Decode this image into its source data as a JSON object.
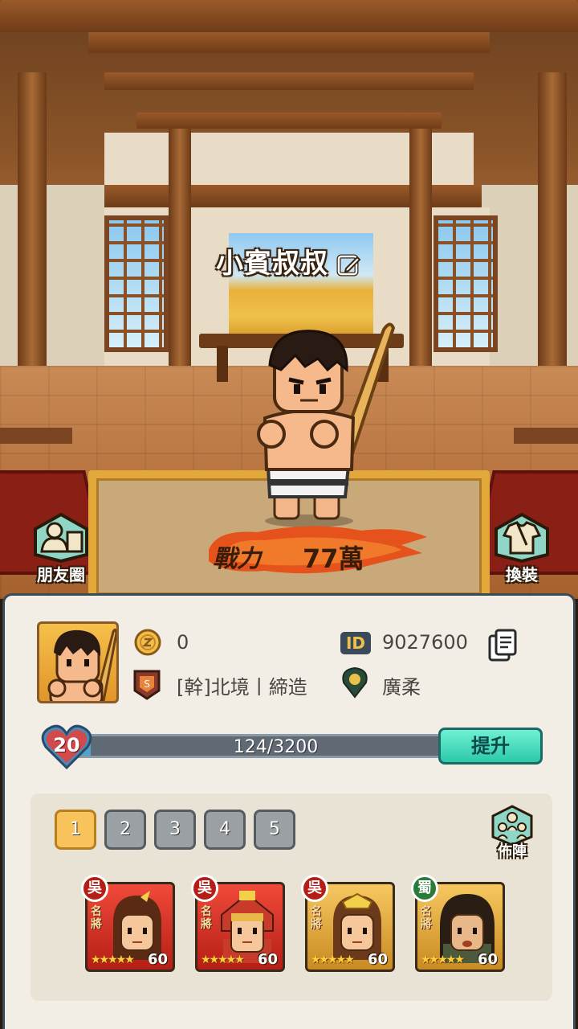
{
  "player": {
    "name": "小賓叔叔",
    "power_label": "戰力",
    "power_value": "77萬"
  },
  "side_buttons": {
    "friends_label": "朋友圈",
    "outfit_label": "換裝"
  },
  "profile": {
    "coins": "0",
    "id_badge": "ID",
    "id_value": "9027600",
    "guild": "[幹]北境丨締造",
    "location": "廣柔"
  },
  "level": {
    "number": "20",
    "progress_text": "124/3200",
    "progress_fraction": 0.039,
    "upgrade_label": "提升"
  },
  "formation": {
    "tabs": [
      "1",
      "2",
      "3",
      "4",
      "5"
    ],
    "active_tab": 0,
    "formation_label": "佈陣",
    "heroes": [
      {
        "faction": "吳",
        "rank": "名將",
        "stars": "★★★★★",
        "level": "60",
        "color": "red"
      },
      {
        "faction": "吳",
        "rank": "名將",
        "stars": "★★★★★",
        "level": "60",
        "color": "red"
      },
      {
        "faction": "吳",
        "rank": "名將",
        "stars": "★★★★★",
        "level": "60",
        "color": "gold"
      },
      {
        "faction": "蜀",
        "rank": "名將",
        "stars": "★★★★★",
        "level": "60",
        "color": "gold"
      }
    ]
  },
  "colors": {
    "upgrade_button": "#2cc9a8",
    "progress_fill": "#4fa3c9",
    "active_tab": "#f7c35a",
    "panel_bg": "#f2eee5"
  },
  "icons": {
    "edit": "edit-icon",
    "coin": "coin-icon",
    "guild": "guild-banner-icon",
    "location": "location-pin-icon",
    "copy": "copy-icon",
    "heart": "heart-icon",
    "friends": "friends-circle-icon",
    "outfit": "outfit-icon",
    "formation": "formation-icon"
  }
}
